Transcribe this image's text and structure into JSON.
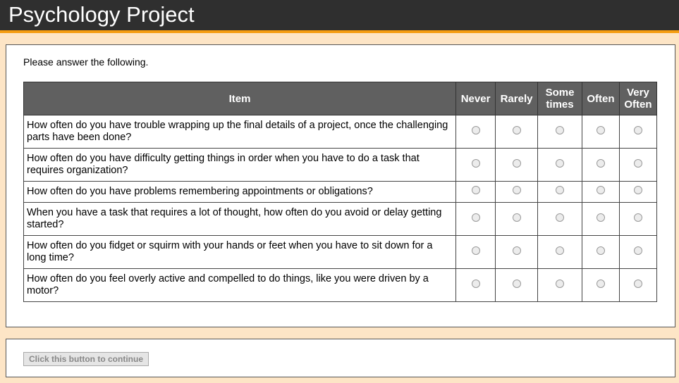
{
  "app": {
    "title": "Psychology Project"
  },
  "survey": {
    "instructions": "Please answer the following.",
    "item_header": "Item",
    "options": [
      {
        "line1": "Never",
        "line2": ""
      },
      {
        "line1": "Rarely",
        "line2": ""
      },
      {
        "line1": "Some",
        "line2": "times"
      },
      {
        "line1": "Often",
        "line2": ""
      },
      {
        "line1": "Very",
        "line2": "Often"
      }
    ],
    "questions": [
      "How often do you have trouble wrapping up the final details of a project, once the challenging parts have been done?",
      "How often do you have difficulty getting things in order when you have to do a task that requires organization?",
      "How often do you have problems remembering appointments or obligations?",
      "When you have a task that requires a lot of thought, how often do you avoid or delay getting started?",
      "How often do you fidget or squirm with your hands or feet when you have to sit down for a long time?",
      "How often do you feel overly active and compelled to do things, like you were driven by a motor?"
    ]
  },
  "footer": {
    "continue_label": "Click this button to continue"
  },
  "colors": {
    "header_bg": "#2f2f2f",
    "accent": "#f59d11",
    "page_bg": "#fde5c6",
    "table_header_bg": "#606060"
  }
}
